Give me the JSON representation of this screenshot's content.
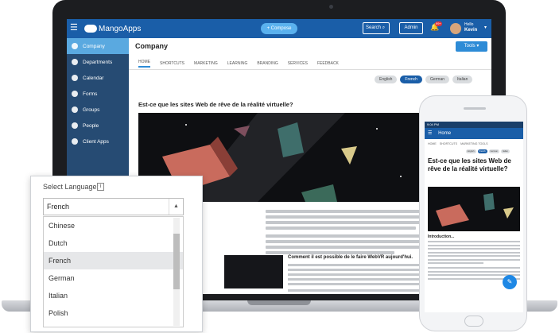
{
  "app": {
    "logo_text": "MangoApps",
    "compose_label": "+ Compose",
    "search_label": "Search",
    "admin_label": "Admin",
    "notification_count": "99+",
    "user_greeting": "Hello",
    "user_name": "Kevin"
  },
  "sidebar": {
    "items": [
      {
        "label": "Company",
        "icon": "globe-icon",
        "active": true
      },
      {
        "label": "Departments",
        "icon": "departments-icon"
      },
      {
        "label": "Calendar",
        "icon": "calendar-icon"
      },
      {
        "label": "Forms",
        "icon": "forms-icon"
      },
      {
        "label": "Groups",
        "icon": "groups-icon"
      },
      {
        "label": "People",
        "icon": "people-icon"
      },
      {
        "label": "Client Apps",
        "icon": "download-icon"
      }
    ]
  },
  "page": {
    "title": "Company",
    "tools_label": "Tools ▾",
    "tabs": [
      "HOME",
      "SHORTCUTS",
      "MARKETING",
      "LEARNING",
      "BRANDING",
      "SERVICES",
      "FEEDBACK"
    ],
    "languages": [
      "English",
      "French",
      "German",
      "Italian"
    ],
    "active_language": "French",
    "article_title": "Est-ce que les sites Web de rêve de la réalité virtuelle?",
    "sub_heading": "Comment il est possible de le faire WebVR aujourd'hui."
  },
  "language_popup": {
    "label": "Select Language:",
    "info_glyph": "i",
    "selected": "French",
    "options": [
      "Chinese",
      "Dutch",
      "French",
      "German",
      "Italian",
      "Polish"
    ],
    "selected_index": 2
  },
  "phone": {
    "status_time": "9:04 PM",
    "nav_title": "Home",
    "tabs": [
      "HOME",
      "SHORTCUTS",
      "MARKETING TOOLS"
    ],
    "languages": [
      "English",
      "French",
      "German",
      "Italian"
    ],
    "article_title": "Est-ce que les sites Web de rêve de la réalité virtuelle?",
    "intro": "Introduction..."
  },
  "colors": {
    "topbar": "#1a5ea8",
    "sidebar": "#264b73",
    "sidebar_active": "#5aa9e0",
    "accent": "#2d8bd6"
  }
}
